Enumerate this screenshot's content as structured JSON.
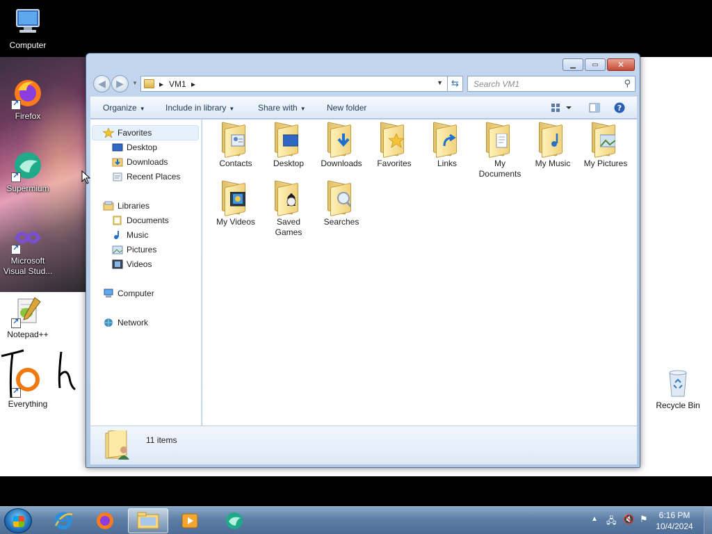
{
  "desktop": {
    "icons": [
      {
        "label": "Computer",
        "icon": "computer-icon"
      },
      {
        "label": "Firefox",
        "icon": "firefox-icon"
      },
      {
        "label": "Supermium",
        "icon": "supermium-icon"
      },
      {
        "label": "Microsoft Visual Stud...",
        "icon": "visual-studio-icon"
      },
      {
        "label": "Notepad++",
        "icon": "notepad-plus-plus-icon"
      },
      {
        "label": "Everything",
        "icon": "everything-icon"
      },
      {
        "label": "Recycle Bin",
        "icon": "recycle-bin-icon"
      }
    ]
  },
  "window": {
    "address": {
      "segments": [
        "VM1"
      ]
    },
    "search_placeholder": "Search VM1",
    "toolbar": {
      "organize": "Organize",
      "include_in_library": "Include in library",
      "share_with": "Share with",
      "new_folder": "New folder"
    },
    "nav": {
      "favorites": "Favorites",
      "favorites_items": [
        "Desktop",
        "Downloads",
        "Recent Places"
      ],
      "libraries": "Libraries",
      "libraries_items": [
        "Documents",
        "Music",
        "Pictures",
        "Videos"
      ],
      "computer": "Computer",
      "network": "Network"
    },
    "items": [
      {
        "label": "Contacts",
        "overlay": "contacts-icon"
      },
      {
        "label": "Desktop",
        "overlay": "desktop-icon"
      },
      {
        "label": "Downloads",
        "overlay": "download-arrow-icon"
      },
      {
        "label": "Favorites",
        "overlay": "star-icon"
      },
      {
        "label": "Links",
        "overlay": "link-arrow-icon"
      },
      {
        "label": "My Documents",
        "overlay": "documents-icon"
      },
      {
        "label": "My Music",
        "overlay": "music-note-icon"
      },
      {
        "label": "My Pictures",
        "overlay": "picture-icon"
      },
      {
        "label": "My Videos",
        "overlay": "video-icon"
      },
      {
        "label": "Saved Games",
        "overlay": "chess-icon"
      },
      {
        "label": "Searches",
        "overlay": "magnifier-icon"
      }
    ],
    "status": {
      "count": "11 items"
    }
  },
  "taskbar": {
    "apps": [
      "internet-explorer-icon",
      "firefox-icon",
      "explorer-icon",
      "media-player-icon",
      "supermium-icon"
    ],
    "clock": {
      "time": "6:16 PM",
      "date": "10/4/2024"
    }
  }
}
